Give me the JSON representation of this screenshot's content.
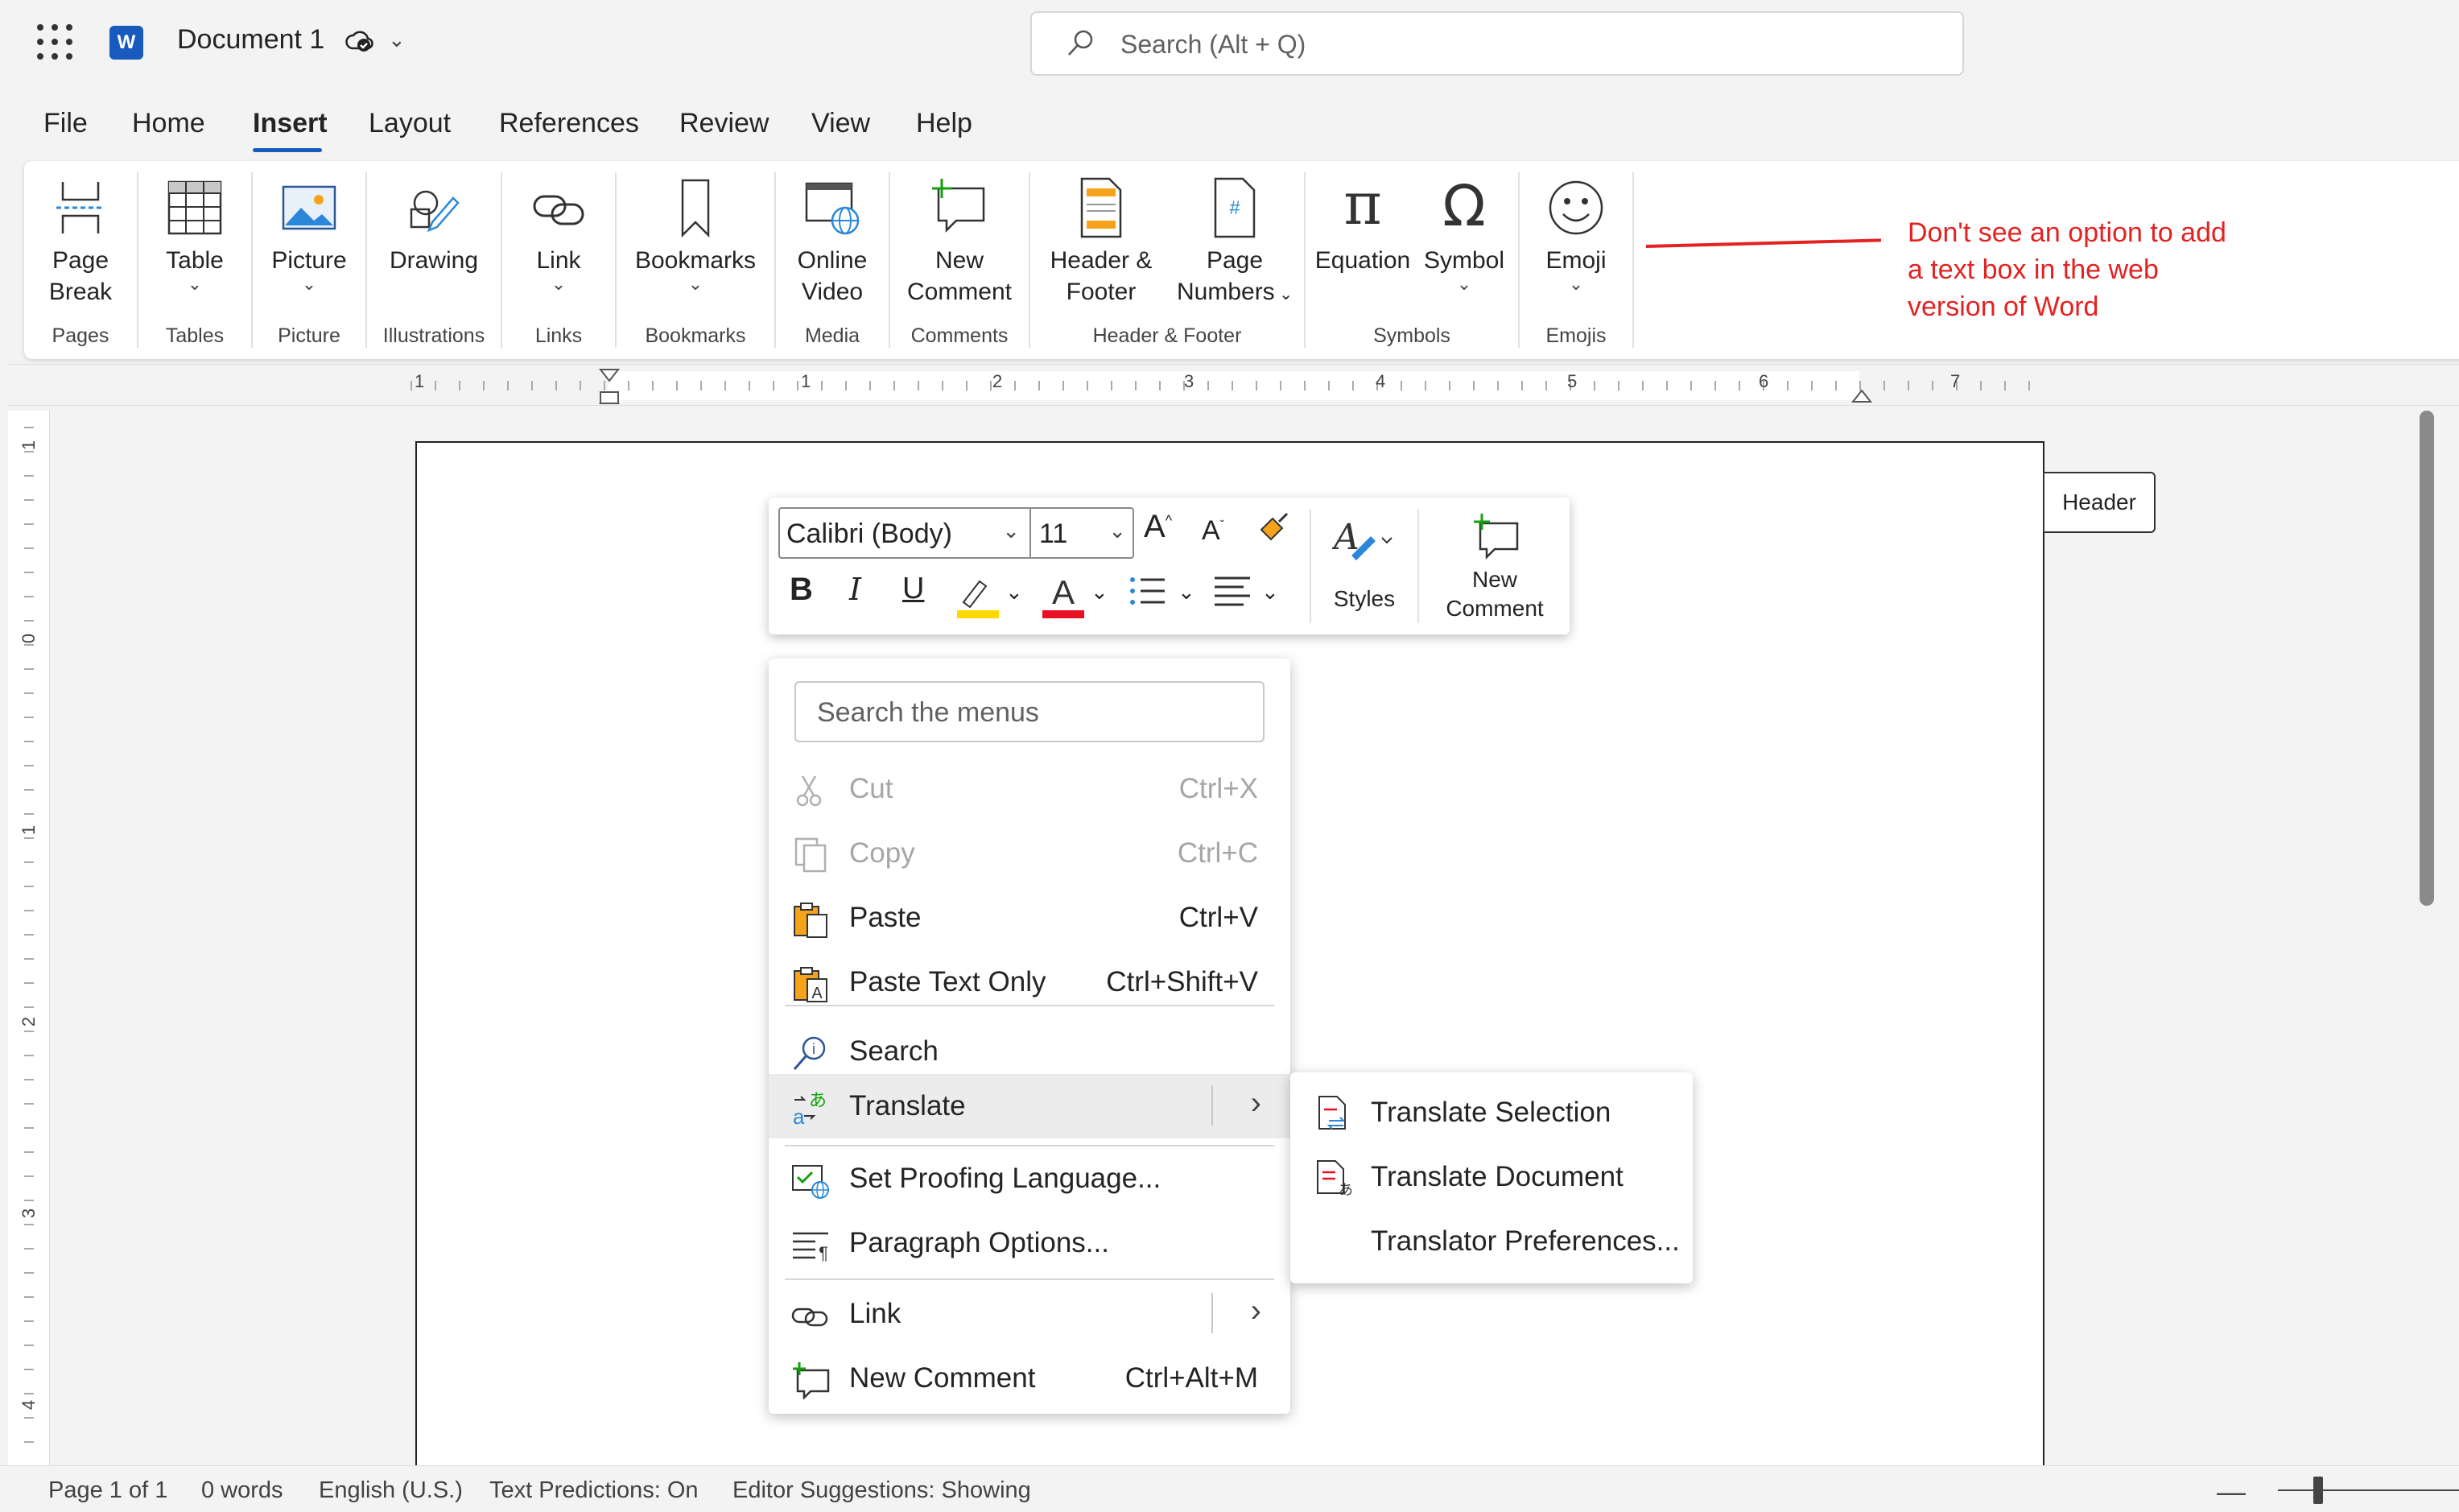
{
  "titlebar": {
    "app_icon_letter": "W",
    "doc_title": "Document 1",
    "search_placeholder": "Search (Alt + Q)"
  },
  "tabs": [
    "File",
    "Home",
    "Insert",
    "Layout",
    "References",
    "Review",
    "View",
    "Help"
  ],
  "active_tab": "Insert",
  "ribbon": {
    "page_break": "Page\nBreak",
    "page_break_l1": "Page",
    "page_break_l2": "Break",
    "pages_group": "Pages",
    "table": "Table",
    "tables_group": "Tables",
    "picture": "Picture",
    "picture_group": "Picture",
    "drawing": "Drawing",
    "illustrations_group": "Illustrations",
    "link": "Link",
    "links_group": "Links",
    "bookmarks": "Bookmarks",
    "bookmarks_group": "Bookmarks",
    "online_video_l1": "Online",
    "online_video_l2": "Video",
    "media_group": "Media",
    "new_comment_l1": "New",
    "new_comment_l2": "Comment",
    "comments_group": "Comments",
    "header_footer_l1": "Header &",
    "header_footer_l2": "Footer",
    "page_numbers_l1": "Page",
    "page_numbers_l2": "Numbers",
    "header_footer_group": "Header & Footer",
    "equation": "Equation",
    "symbol": "Symbol",
    "symbols_group": "Symbols",
    "emoji": "Emoji",
    "emojis_group": "Emojis"
  },
  "annotation": {
    "text": "Don't see an option to add a text box in the web version of Word",
    "color": "#e32222"
  },
  "ruler": {
    "h_numbers": [
      "1",
      "1",
      "2",
      "3",
      "4",
      "5",
      "6",
      "7"
    ],
    "v_numbers": [
      "1",
      "0",
      "1",
      "2",
      "3",
      "4"
    ]
  },
  "header_tag": "Header",
  "minibar": {
    "font": "Calibri (Body)",
    "size": "11",
    "styles": "Styles",
    "new_comment_l1": "New",
    "new_comment_l2": "Comment",
    "highlight_color": "#ffd800",
    "font_color": "#e81123"
  },
  "context_menu": {
    "search_placeholder": "Search the menus",
    "items": [
      {
        "label": "Cut",
        "shortcut": "Ctrl+X",
        "disabled": true
      },
      {
        "label": "Copy",
        "shortcut": "Ctrl+C",
        "disabled": true
      },
      {
        "label": "Paste",
        "shortcut": "Ctrl+V"
      },
      {
        "label": "Paste Text Only",
        "shortcut": "Ctrl+Shift+V"
      },
      {
        "label": "Search"
      },
      {
        "label": "Translate",
        "arrow": "›"
      },
      {
        "label": "Set Proofing Language..."
      },
      {
        "label": "Paragraph Options..."
      },
      {
        "label": "Link",
        "arrow": "›"
      },
      {
        "label": "New Comment",
        "shortcut": "Ctrl+Alt+M"
      }
    ]
  },
  "translate_submenu": {
    "items": [
      "Translate Selection",
      "Translate Document",
      "Translator Preferences..."
    ]
  },
  "statusbar": {
    "page": "Page 1 of 1",
    "words": "0 words",
    "language": "English (U.S.)",
    "predictions": "Text Predictions: On",
    "editor": "Editor Suggestions: Showing"
  },
  "colors": {
    "accent": "#185abd",
    "background": "#f3f3f3"
  }
}
